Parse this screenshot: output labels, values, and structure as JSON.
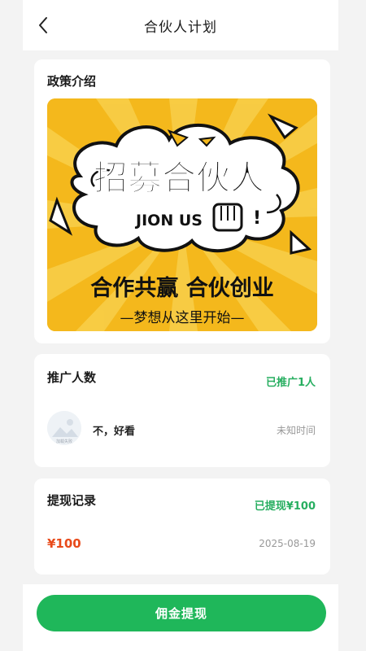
{
  "header": {
    "title": "合伙人计划",
    "back_icon": "chevron-left-icon"
  },
  "policy": {
    "title": "政策介绍",
    "banner": {
      "headline": "招募合伙人",
      "subline": "JION US",
      "exclaim": "!",
      "slogan": "合作共赢 合伙创业",
      "tagline": "—梦想从这里开始—",
      "colors": {
        "bg": "#f4b81c",
        "ray": "#f8cf4a",
        "text": "#111111"
      }
    }
  },
  "promotion": {
    "title": "推广人数",
    "status": "已推广1人",
    "items": [
      {
        "name": "不，好看",
        "time": "未知时间",
        "avatar_text": "加载失败"
      }
    ]
  },
  "withdraw": {
    "title": "提现记录",
    "status": "已提现¥100",
    "records": [
      {
        "amount": "¥100",
        "date": "2025-08-19"
      }
    ]
  },
  "cta": {
    "label": "佣金提现"
  },
  "colors": {
    "accent": "#1fb75a",
    "status_green": "#27ae60",
    "amount_red": "#e84a1a"
  }
}
